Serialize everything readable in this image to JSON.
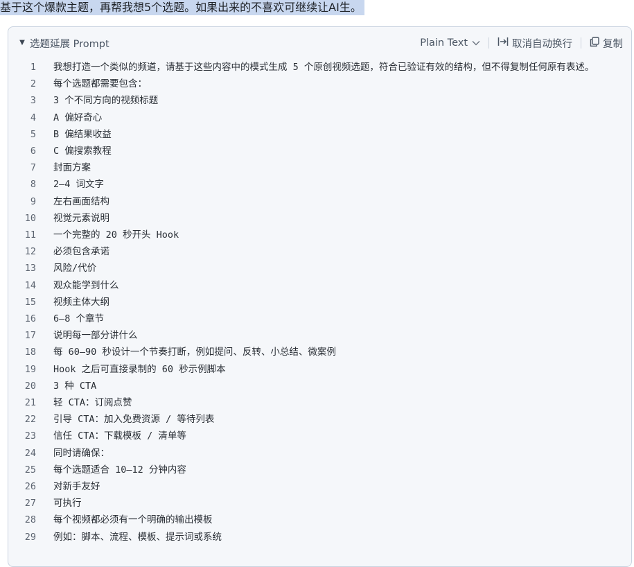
{
  "prompt_line": "基于这个爆款主题，再帮我想5个选题。如果出来的不喜欢可继续让AI生。",
  "code_block": {
    "title": "选题延展 Prompt",
    "language": "Plain Text",
    "wrap_toggle_label": "取消自动换行",
    "copy_label": "复制",
    "icons": {
      "collapse": "triangle-down-icon",
      "language_dropdown": "chevron-down-icon",
      "wrap": "wrap-toggle-icon",
      "copy": "copy-icon"
    },
    "lines": [
      {
        "n": "1",
        "text": "我想打造一个类似的频道，请基于这些内容中的模式生成 5 个原创视频选题，符合已验证有效的结构，但不得复制任何原有表述。"
      },
      {
        "n": "2",
        "text": "每个选题都需要包含："
      },
      {
        "n": "3",
        "text": " 3 个不同方向的视频标题"
      },
      {
        "n": "4",
        "text": " A 偏好奇心"
      },
      {
        "n": "5",
        "text": " B 偏结果收益"
      },
      {
        "n": "6",
        "text": " C 偏搜索教程"
      },
      {
        "n": "7",
        "text": " 封面方案"
      },
      {
        "n": "8",
        "text": " 2–4 词文字"
      },
      {
        "n": "9",
        "text": " 左右画面结构"
      },
      {
        "n": "10",
        "text": " 视觉元素说明"
      },
      {
        "n": "11",
        "text": " 一个完整的 20 秒开头 Hook"
      },
      {
        "n": "12",
        "text": " 必须包含承诺"
      },
      {
        "n": "13",
        "text": " 风险/代价"
      },
      {
        "n": "14",
        "text": " 观众能学到什么"
      },
      {
        "n": "15",
        "text": " 视频主体大纲"
      },
      {
        "n": "16",
        "text": " 6–8 个章节"
      },
      {
        "n": "17",
        "text": " 说明每一部分讲什么"
      },
      {
        "n": "18",
        "text": " 每 60–90 秒设计一个节奏打断，例如提问、反转、小总结、微案例"
      },
      {
        "n": "19",
        "text": " Hook 之后可直接录制的 60 秒示例脚本"
      },
      {
        "n": "20",
        "text": " 3 种 CTA"
      },
      {
        "n": "21",
        "text": " 轻 CTA：订阅点赞"
      },
      {
        "n": "22",
        "text": " 引导 CTA：加入免费资源 / 等待列表"
      },
      {
        "n": "23",
        "text": " 信任 CTA：下载模板 / 清单等"
      },
      {
        "n": "24",
        "text": "同时请确保："
      },
      {
        "n": "25",
        "text": " 每个选题适合 10–12 分钟内容"
      },
      {
        "n": "26",
        "text": " 对新手友好"
      },
      {
        "n": "27",
        "text": " 可执行"
      },
      {
        "n": "28",
        "text": " 每个视频都必须有一个明确的输出模板"
      },
      {
        "n": "29",
        "text": " 例如：脚本、流程、模板、提示词或系统"
      }
    ]
  }
}
